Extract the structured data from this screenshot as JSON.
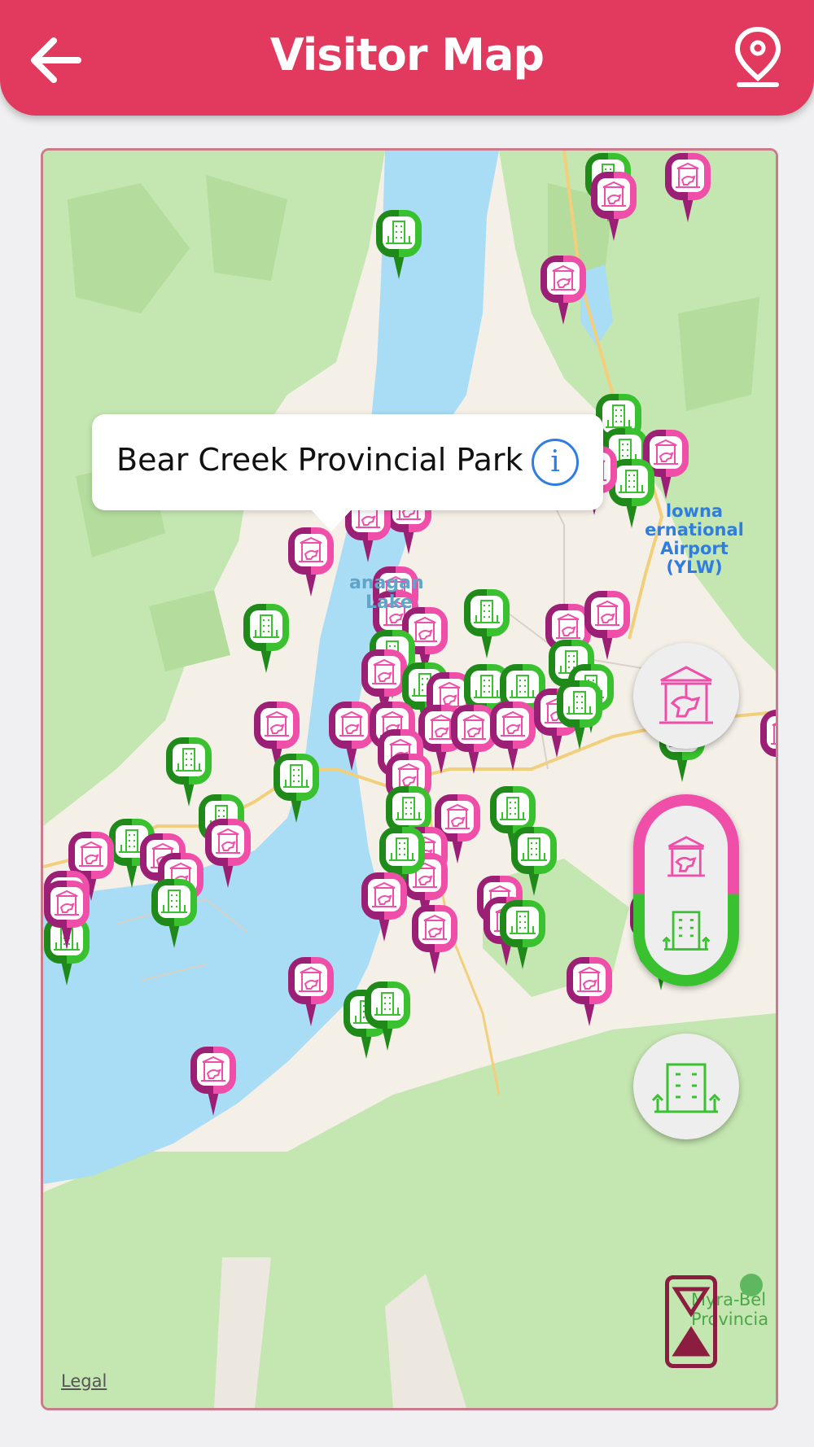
{
  "header": {
    "title": "Visitor Map",
    "back_icon": "arrow-left-icon",
    "location_icon": "location-pin-icon"
  },
  "callout": {
    "title": "Bear Creek Provincial Park",
    "info_symbol": "i"
  },
  "map_labels": {
    "airport": "Kelowna International Airport (YLW)",
    "airport_line1": "lowna",
    "airport_line2": "ernational",
    "airport_line3": "Airport (YLW)",
    "lake_line1": "anagan",
    "lake_line2": "Lake",
    "park_line1": "Myra-Bel",
    "park_line2": "Provincia",
    "legal": "Legal"
  },
  "filters": {
    "attractions": {
      "icon": "carousel-icon",
      "color": "#ef4fa8"
    },
    "both": {
      "icons": [
        "carousel-icon",
        "hotel-icon"
      ]
    },
    "hotels": {
      "icon": "hotel-icon",
      "color": "#3ac12f"
    }
  },
  "colors": {
    "header": "#e23a5e",
    "attraction_pin": "#ef4fa8",
    "attraction_pin_dark": "#9a1f75",
    "hotel_pin": "#3ac12f",
    "hotel_pin_dark": "#1f8a1a",
    "water": "#a9dcf5",
    "park": "#c4e6b0"
  }
}
